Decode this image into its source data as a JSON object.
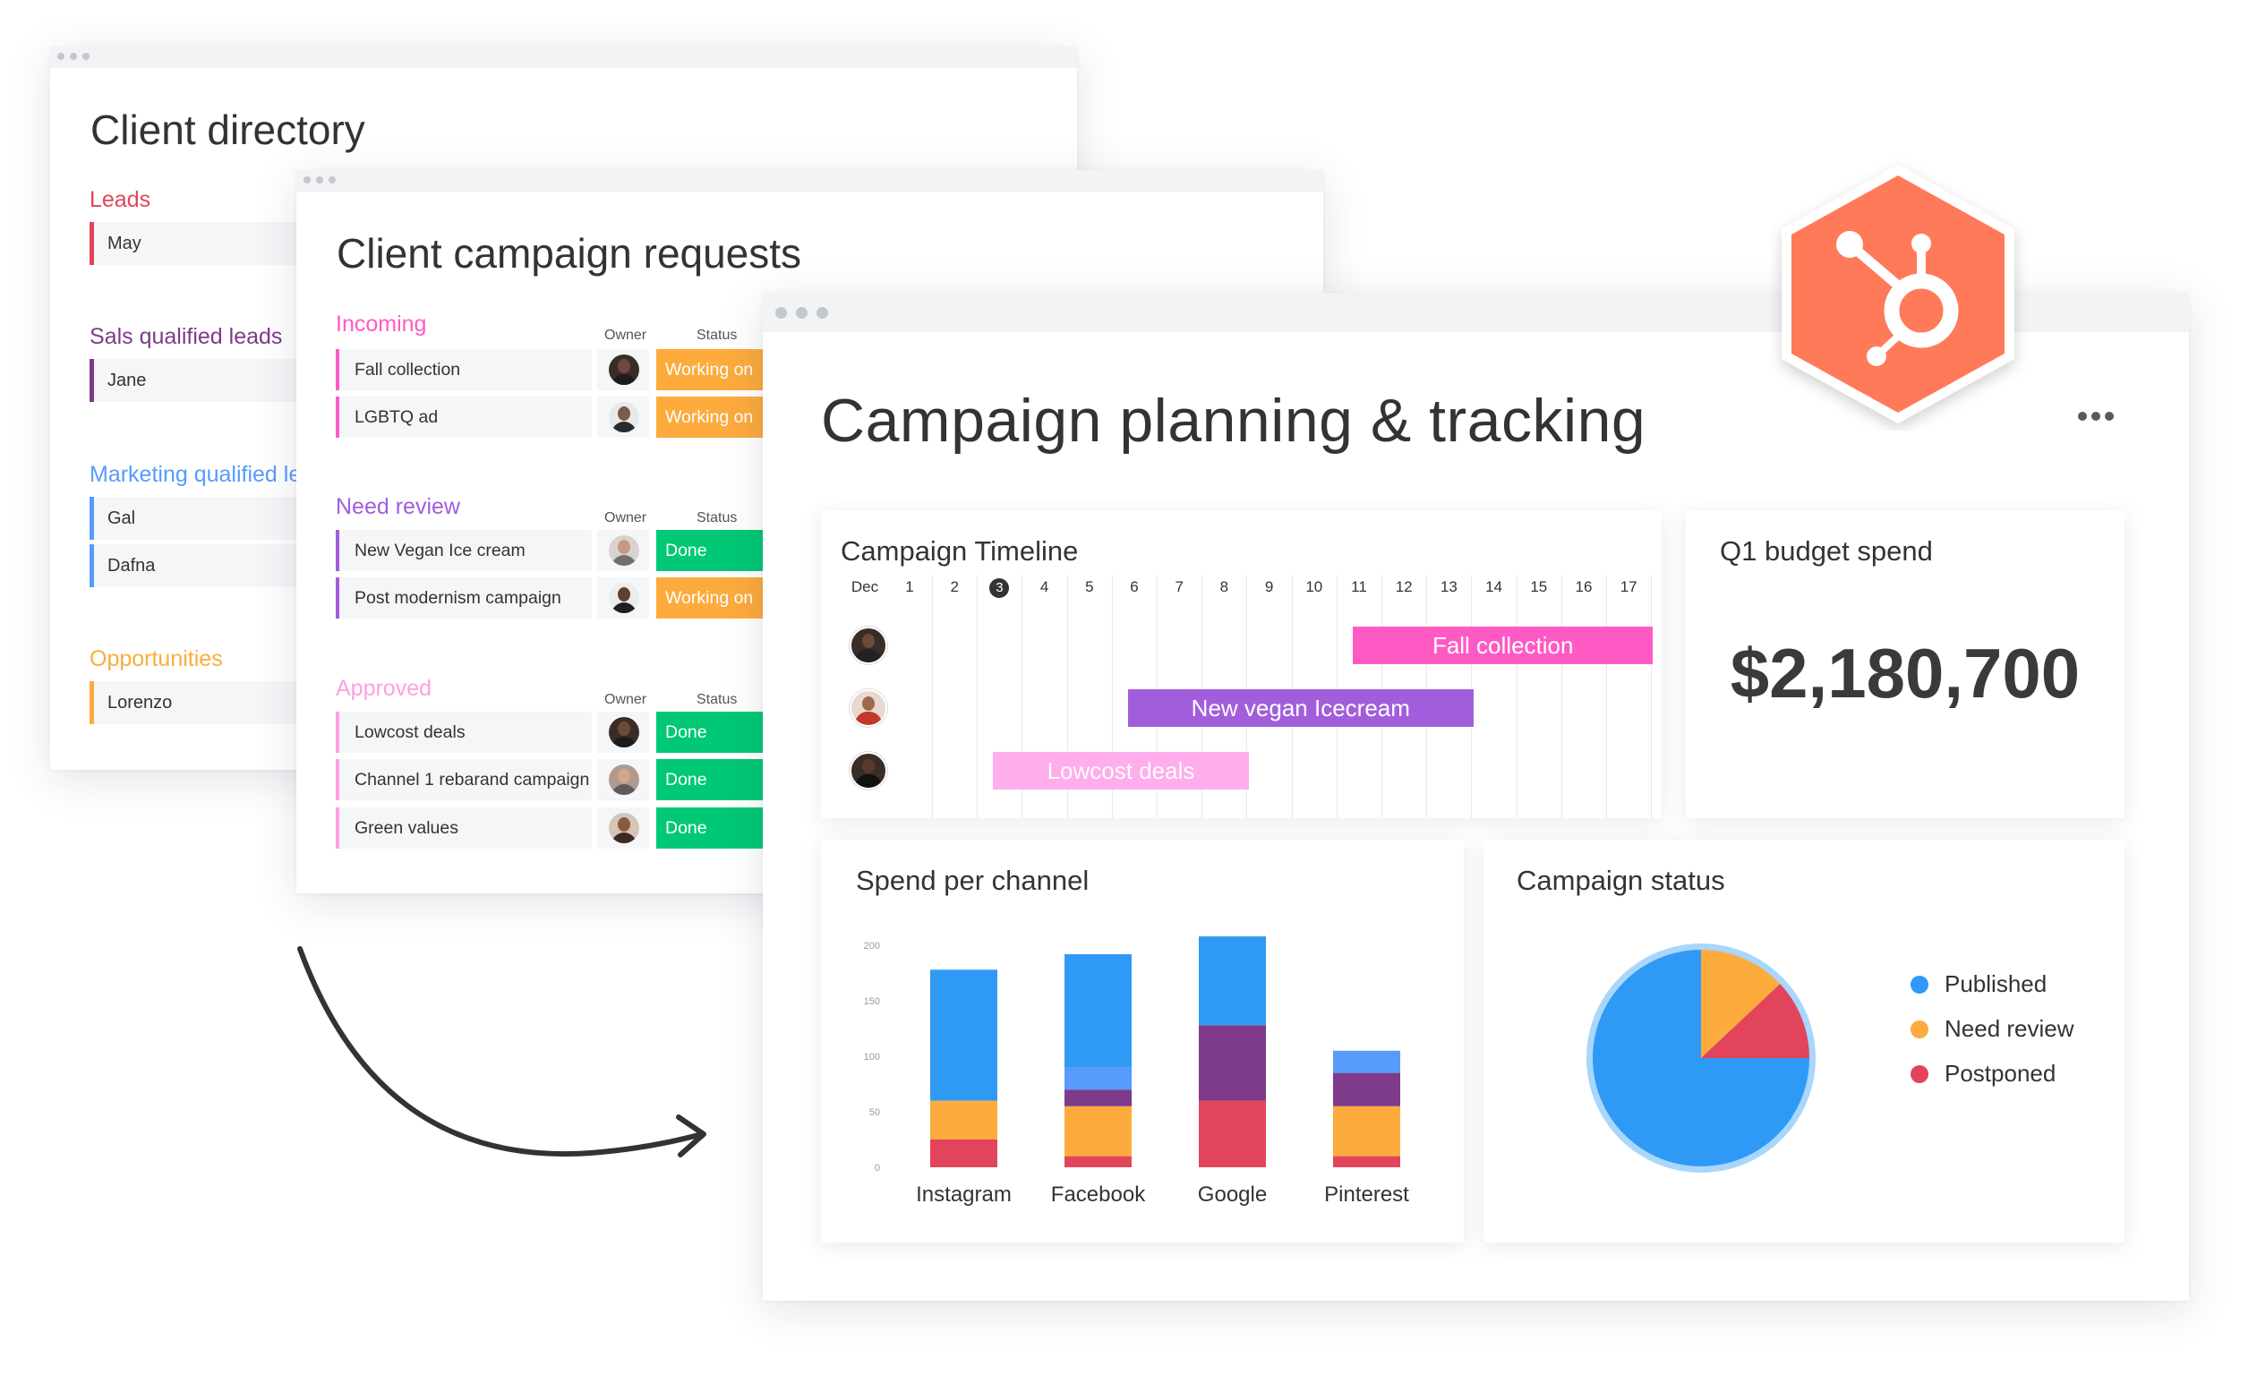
{
  "client_directory": {
    "title": "Client directory",
    "groups": [
      {
        "title": "Leads",
        "color": "#e2445c",
        "items": [
          "May"
        ]
      },
      {
        "title": "Sals qualified leads",
        "color": "#7e3b8a",
        "items": [
          "Jane"
        ]
      },
      {
        "title": "Marketing qualified le",
        "color": "#579bfc",
        "items": [
          "Gal",
          "Dafna"
        ]
      },
      {
        "title": "Opportunities",
        "color": "#fdab3d",
        "items": [
          "Lorenzo"
        ]
      }
    ]
  },
  "campaign_requests": {
    "title": "Client campaign requests",
    "owner_header": "Owner",
    "status_header": "Status",
    "groups": [
      {
        "title": "Incoming",
        "color": "#ff5ac4",
        "rows": [
          {
            "name": "Fall collection",
            "status": "Working on"
          },
          {
            "name": "LGBTQ ad",
            "status": "Working on"
          }
        ]
      },
      {
        "title": "Need review",
        "color": "#a25ddc",
        "rows": [
          {
            "name": "New Vegan Ice cream",
            "status": "Done"
          },
          {
            "name": "Post modernism campaign",
            "status": "Working on"
          }
        ]
      },
      {
        "title": "Approved",
        "color": "#ff9ee2",
        "rows": [
          {
            "name": "Lowcost deals",
            "status": "Done"
          },
          {
            "name": "Channel 1 rebarand campaign",
            "status": "Done"
          },
          {
            "name": "Green values",
            "status": "Done"
          }
        ]
      }
    ],
    "status_colors": {
      "Working on": "#fdab3d",
      "Done": "#00c875"
    }
  },
  "dashboard": {
    "title": "Campaign planning & tracking",
    "timeline": {
      "title": "Campaign Timeline",
      "month": "Dec",
      "days": [
        "1",
        "2",
        "3",
        "4",
        "5",
        "6",
        "7",
        "8",
        "9",
        "10",
        "11",
        "12",
        "13",
        "14",
        "15",
        "16",
        "17"
      ],
      "today": "3",
      "items": [
        {
          "label": "Fall collection",
          "start_day": 11,
          "end_day": 17,
          "color": "#ff5ac4"
        },
        {
          "label": "New vegan Icecream",
          "start_day": 6,
          "end_day": 13,
          "color": "#a25ddc"
        },
        {
          "label": "Lowcost deals",
          "start_day": 3,
          "end_day": 8,
          "color": "#ffadeb"
        }
      ]
    },
    "budget": {
      "title": "Q1 budget spend",
      "value": "$2,180,700"
    },
    "spend_per_channel": {
      "title": "Spend per channel"
    },
    "campaign_status": {
      "title": "Campaign status"
    }
  },
  "chart_data": [
    {
      "type": "bar",
      "title": "Spend per channel",
      "stacked": true,
      "categories": [
        "Instagram",
        "Facebook",
        "Google",
        "Pinterest"
      ],
      "yticks": [
        "0",
        "50",
        "100",
        "150",
        "200"
      ],
      "ylim": [
        0,
        200
      ],
      "grid": false,
      "series": [
        {
          "values": [
            25,
            10,
            60,
            10
          ],
          "color": "#e2445c"
        },
        {
          "values": [
            0,
            0,
            0,
            0
          ],
          "color": "#fdab3d"
        },
        {
          "values": [
            35,
            45,
            0,
            45
          ],
          "color": "#fdab3d"
        },
        {
          "values": [
            0,
            15,
            68,
            30
          ],
          "color": "#7e3b8a"
        },
        {
          "values": [
            0,
            20,
            0,
            20
          ],
          "color": "#579bfc"
        },
        {
          "values": [
            118,
            102,
            80,
            0
          ],
          "color": "#2f9af5"
        }
      ]
    },
    {
      "type": "pie",
      "title": "Campaign status",
      "legend": "right",
      "labels": [
        "Published",
        "Need review",
        "Postponed"
      ],
      "values": [
        75,
        13,
        12
      ],
      "colors": [
        "#2f9af5",
        "#fdab3d",
        "#e2445c"
      ]
    }
  ],
  "icons": {
    "hubspot_logo": "hubspot-sprocket-icon",
    "hubspot_color": "#ff7a59",
    "arrow": "curved-arrow-icon"
  }
}
